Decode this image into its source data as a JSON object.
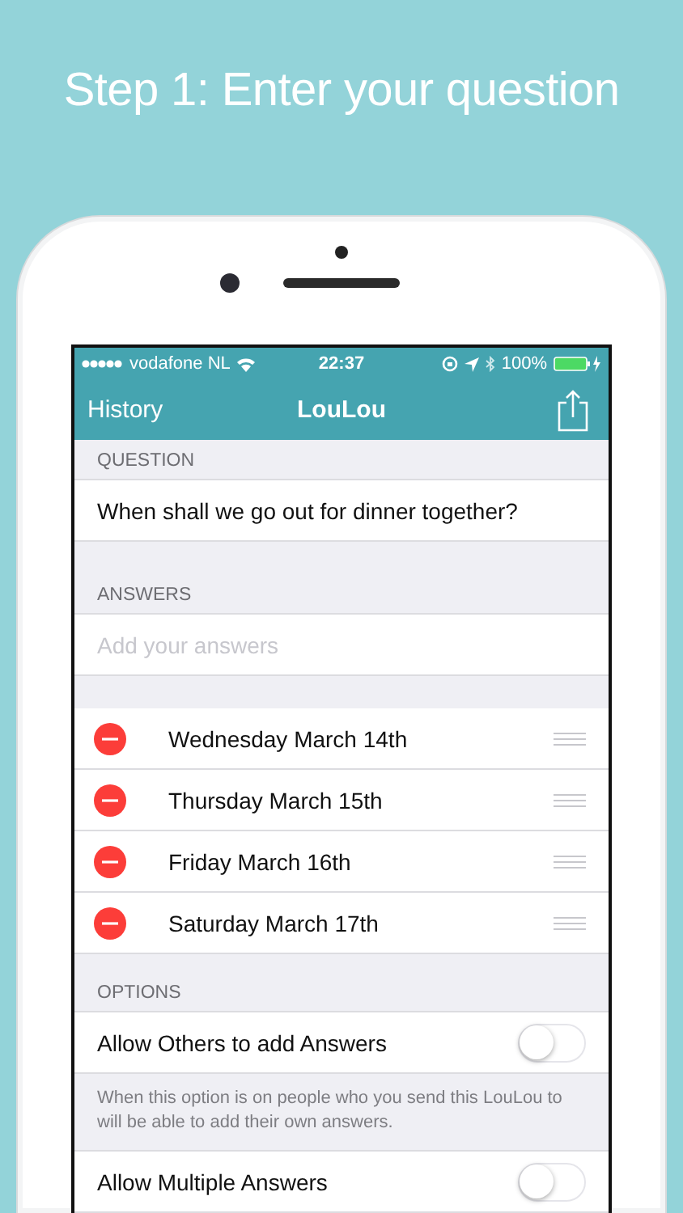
{
  "headline": "Step 1: Enter your question",
  "status_bar": {
    "carrier": "vodafone NL",
    "time": "22:37",
    "battery": "100%"
  },
  "nav": {
    "back": "History",
    "title": "LouLou"
  },
  "question": {
    "header": "QUESTION",
    "text": "When shall we go out for dinner together?"
  },
  "answers": {
    "header": "ANSWERS",
    "placeholder": "Add your answers",
    "items": [
      {
        "label": "Wednesday March 14th"
      },
      {
        "label": "Thursday March 15th"
      },
      {
        "label": "Friday March 16th"
      },
      {
        "label": "Saturday March 17th"
      }
    ]
  },
  "options": {
    "header": "OPTIONS",
    "items": [
      {
        "label": "Allow Others to add Answers",
        "on": false,
        "note": "When this option is on people who you send this LouLou to will be able to add their own answers."
      },
      {
        "label": "Allow Multiple Answers",
        "on": false
      }
    ]
  }
}
